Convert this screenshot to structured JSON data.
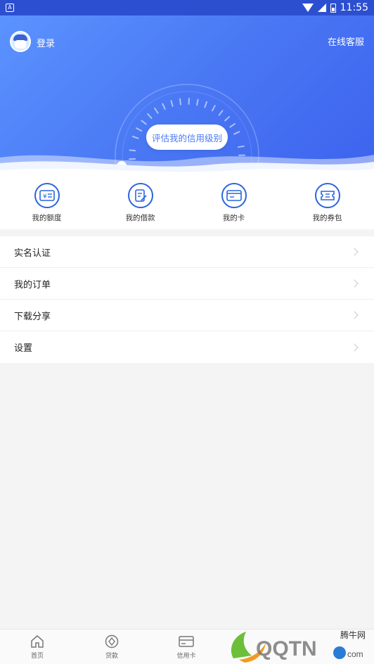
{
  "status_bar": {
    "notification_icon": "A",
    "time": "11:55"
  },
  "header": {
    "login_label": "登录",
    "service_label": "在线客服",
    "evaluate_button": "评估我的信用级别",
    "avatar_icon": "user-avatar-icon",
    "colors": {
      "gradient_start": "#5b93ff",
      "gradient_end": "#3c63ee",
      "accent": "#4a78f4"
    }
  },
  "quick_menu": [
    {
      "label": "我的额度",
      "icon": "quota-card-icon"
    },
    {
      "label": "我的借款",
      "icon": "loan-document-icon"
    },
    {
      "label": "我的卡",
      "icon": "bank-card-icon"
    },
    {
      "label": "我的券包",
      "icon": "coupon-icon"
    }
  ],
  "menu": [
    {
      "label": "实名认证"
    },
    {
      "label": "我的订单"
    },
    {
      "label": "下载分享"
    },
    {
      "label": "设置"
    }
  ],
  "bottom_nav": [
    {
      "label": "首页",
      "icon": "home-icon"
    },
    {
      "label": "贷款",
      "icon": "loan-icon"
    },
    {
      "label": "信用卡",
      "icon": "credit-card-icon"
    }
  ],
  "watermark": {
    "text": "腾牛网"
  }
}
